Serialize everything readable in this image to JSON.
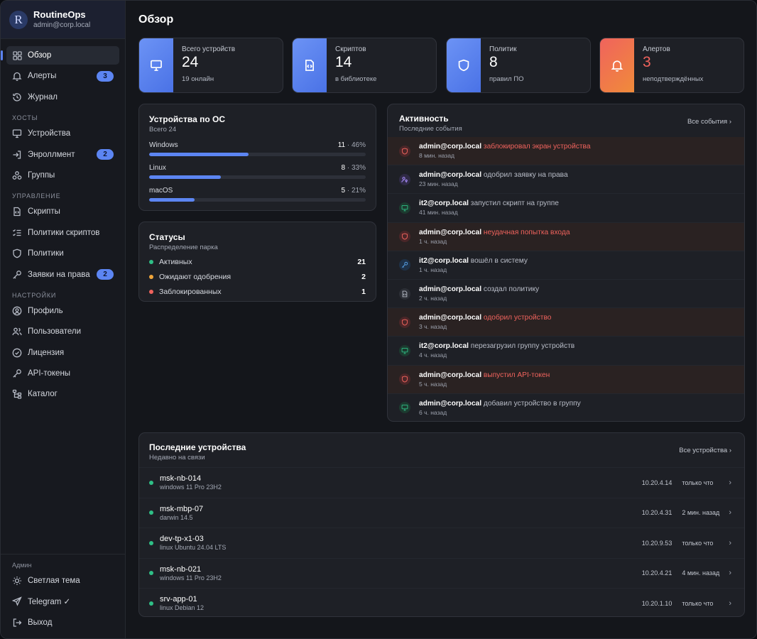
{
  "brand": {
    "logo_letter": "R",
    "name": "RoutineOps",
    "user": "admin@corp.local"
  },
  "nav": {
    "main": [
      {
        "label": "Обзор",
        "icon": "grid-icon",
        "active": true
      },
      {
        "label": "Алерты",
        "icon": "bell-icon",
        "badge": "3"
      },
      {
        "label": "Журнал",
        "icon": "history-icon"
      }
    ],
    "hosts_title": "ХОСТЫ",
    "hosts": [
      {
        "label": "Устройства",
        "icon": "monitor-icon"
      },
      {
        "label": "Энроллмент",
        "icon": "login-icon",
        "badge": "2"
      },
      {
        "label": "Группы",
        "icon": "groups-icon"
      }
    ],
    "manage_title": "УПРАВЛЕНИЕ",
    "manage": [
      {
        "label": "Скрипты",
        "icon": "script-icon"
      },
      {
        "label": "Политики скриптов",
        "icon": "checklist-icon"
      },
      {
        "label": "Политики",
        "icon": "shield-icon"
      },
      {
        "label": "Заявки на права",
        "icon": "key-icon",
        "badge": "2"
      }
    ],
    "settings_title": "НАСТРОЙКИ",
    "settings": [
      {
        "label": "Профиль",
        "icon": "user-circle-icon"
      },
      {
        "label": "Пользователи",
        "icon": "users-icon"
      },
      {
        "label": "Лицензия",
        "icon": "check-circle-icon"
      },
      {
        "label": "API-токены",
        "icon": "key-icon"
      },
      {
        "label": "Каталог",
        "icon": "tree-icon"
      }
    ]
  },
  "bottom": {
    "label": "Админ",
    "items": [
      {
        "label": "Светлая тема",
        "icon": "sun-icon"
      },
      {
        "label": "Telegram ✓",
        "icon": "send-icon"
      },
      {
        "label": "Выход",
        "icon": "logout-icon"
      }
    ]
  },
  "page_title": "Обзор",
  "stats": [
    {
      "label": "Всего устройств",
      "value": "24",
      "sub": "19 онлайн",
      "icon": "monitor-icon",
      "color": "#5c85f2"
    },
    {
      "label": "Скриптов",
      "value": "14",
      "sub": "в библиотеке",
      "icon": "script-icon",
      "color": "#5c85f2"
    },
    {
      "label": "Политик",
      "value": "8",
      "sub": "правил ПО",
      "icon": "shield-icon",
      "color": "#5c85f2"
    },
    {
      "label": "Алертов",
      "value": "3",
      "sub": "неподтверждённых",
      "icon": "bell-icon",
      "color": "#f0635d"
    }
  ],
  "os_card": {
    "title": "Устройства по ОС",
    "sub": "Всего 24",
    "rows": [
      {
        "name": "Windows",
        "count": "11",
        "pct": "46%",
        "fill": 0.46
      },
      {
        "name": "Linux",
        "count": "8",
        "pct": "33%",
        "fill": 0.33
      },
      {
        "name": "macOS",
        "count": "5",
        "pct": "21%",
        "fill": 0.21
      }
    ]
  },
  "status_card": {
    "title": "Статусы",
    "sub": "Распределение парка",
    "rows": [
      {
        "label": "Активных",
        "value": "21",
        "color": "#2fbf86"
      },
      {
        "label": "Ожидают одобрения",
        "value": "2",
        "color": "#f0a53a"
      },
      {
        "label": "Заблокированных",
        "value": "1",
        "color": "#f0635d"
      }
    ]
  },
  "activity": {
    "title": "Активность",
    "sub": "Последние события",
    "link": "Все события",
    "rows": [
      {
        "who": "admin@corp.local",
        "action": "заблокировал экран устройства",
        "time": "8 мин. назад",
        "kind": "alert",
        "icon": "shield-icon"
      },
      {
        "who": "admin@corp.local",
        "action": "одобрил заявку на права",
        "time": "23 мин. назад",
        "kind": "purple",
        "icon": "user-key-icon"
      },
      {
        "who": "it2@corp.local",
        "action": "запустил скрипт на группе",
        "time": "41 мин. назад",
        "kind": "green",
        "icon": "monitor-icon"
      },
      {
        "who": "admin@corp.local",
        "action": "неудачная попытка входа",
        "time": "1 ч. назад",
        "kind": "alert",
        "icon": "shield-icon"
      },
      {
        "who": "it2@corp.local",
        "action": "вошёл в систему",
        "time": "1 ч. назад",
        "kind": "blue",
        "icon": "key-icon"
      },
      {
        "who": "admin@corp.local",
        "action": "создал политику",
        "time": "2 ч. назад",
        "kind": "gray",
        "icon": "script-icon"
      },
      {
        "who": "admin@corp.local",
        "action": "одобрил устройство",
        "time": "3 ч. назад",
        "kind": "alert",
        "icon": "shield-icon"
      },
      {
        "who": "it2@corp.local",
        "action": "перезагрузил группу устройств",
        "time": "4 ч. назад",
        "kind": "green",
        "icon": "monitor-icon"
      },
      {
        "who": "admin@corp.local",
        "action": "выпустил API-токен",
        "time": "5 ч. назад",
        "kind": "alert",
        "icon": "shield-icon"
      },
      {
        "who": "admin@corp.local",
        "action": "добавил устройство в группу",
        "time": "6 ч. назад",
        "kind": "green",
        "icon": "monitor-icon"
      }
    ]
  },
  "devices": {
    "title": "Последние устройства",
    "sub": "Недавно на связи",
    "link": "Все устройства",
    "rows": [
      {
        "name": "msk-nb-014",
        "os": "windows 11 Pro 23H2",
        "ip": "10.20.4.14",
        "seen": "только что"
      },
      {
        "name": "msk-mbp-07",
        "os": "darwin 14.5",
        "ip": "10.20.4.31",
        "seen": "2 мин. назад"
      },
      {
        "name": "dev-tp-x1-03",
        "os": "linux Ubuntu 24.04 LTS",
        "ip": "10.20.9.53",
        "seen": "только что"
      },
      {
        "name": "msk-nb-021",
        "os": "windows 11 Pro 23H2",
        "ip": "10.20.4.21",
        "seen": "4 мин. назад"
      },
      {
        "name": "srv-app-01",
        "os": "linux Debian 12",
        "ip": "10.20.1.10",
        "seen": "только что"
      }
    ]
  }
}
